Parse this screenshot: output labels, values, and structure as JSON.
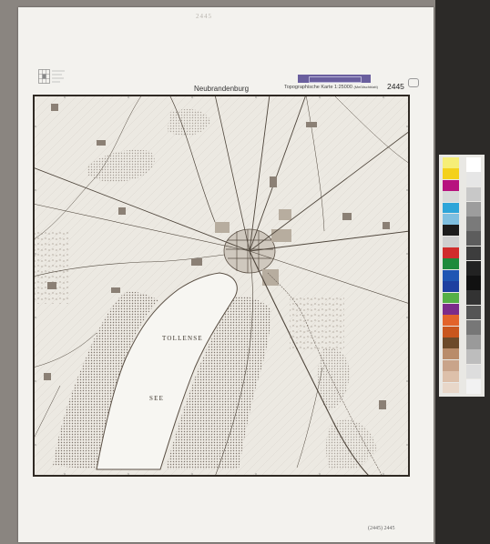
{
  "map": {
    "title": "Neubrandenburg",
    "series": "Topographische Karte 1:25000",
    "series_suffix": "(Meßtischblatt)",
    "sheet_number": "2445",
    "lake_label_top": "TOLLENSE",
    "lake_label_bottom": "SEE",
    "pencil_note": "2445",
    "archive_note": "(2445) 2445"
  },
  "colors": {
    "paper": "#f3f2ee",
    "ink": "#5a4f44",
    "stamp": "#6a5f9e"
  },
  "color_calibration": {
    "left_column": [
      "#f6ee77",
      "#f4d11c",
      "#b7127e",
      "#d8d8d8",
      "#2ea5d9",
      "#7fbfe0",
      "#1c1c1c",
      "#cfcfcf",
      "#d02c2c",
      "#1d8a3b",
      "#1f56b3",
      "#1e3fa0",
      "#55b046",
      "#7c2c8a",
      "#e3632a",
      "#c9561e",
      "#6c4a2a",
      "#b98c6a",
      "#c9a48a",
      "#ddc0aa",
      "#e8d7c9"
    ],
    "right_column": [
      "#ffffff",
      "#e6e6e6",
      "#c8c8c8",
      "#9d9d9d",
      "#7a7a7a",
      "#5d5d5d",
      "#3d3d3d",
      "#222222",
      "#111111",
      "#333333",
      "#555555",
      "#777777",
      "#9a9a9a",
      "#bdbdbd",
      "#dddddd",
      "#f2f2f2"
    ]
  }
}
